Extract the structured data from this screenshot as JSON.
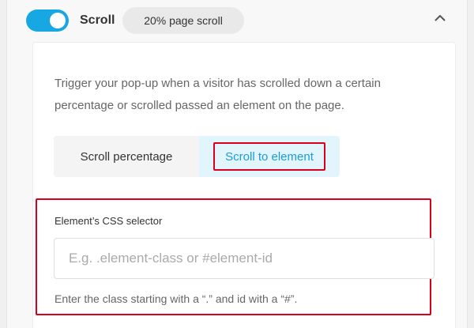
{
  "header": {
    "toggle_on": true,
    "title": "Scroll",
    "badge": "20% page scroll",
    "collapse_icon": "chevron-up-icon"
  },
  "body": {
    "description": "Trigger your pop-up when a visitor has scrolled down a certain percentage or scrolled passed an element on the page.",
    "tabs": [
      {
        "label": "Scroll percentage",
        "active": false
      },
      {
        "label": "Scroll to element",
        "active": true
      }
    ],
    "selector_field": {
      "label": "Element’s CSS selector",
      "value": "",
      "placeholder": "E.g. .element-class or #element-id",
      "help": "Enter the class starting with a “.” and id with a “#”."
    }
  },
  "colors": {
    "accent": "#17a8e3",
    "highlight": "#d9001b",
    "active_tab_bg": "#e3f5fc"
  }
}
